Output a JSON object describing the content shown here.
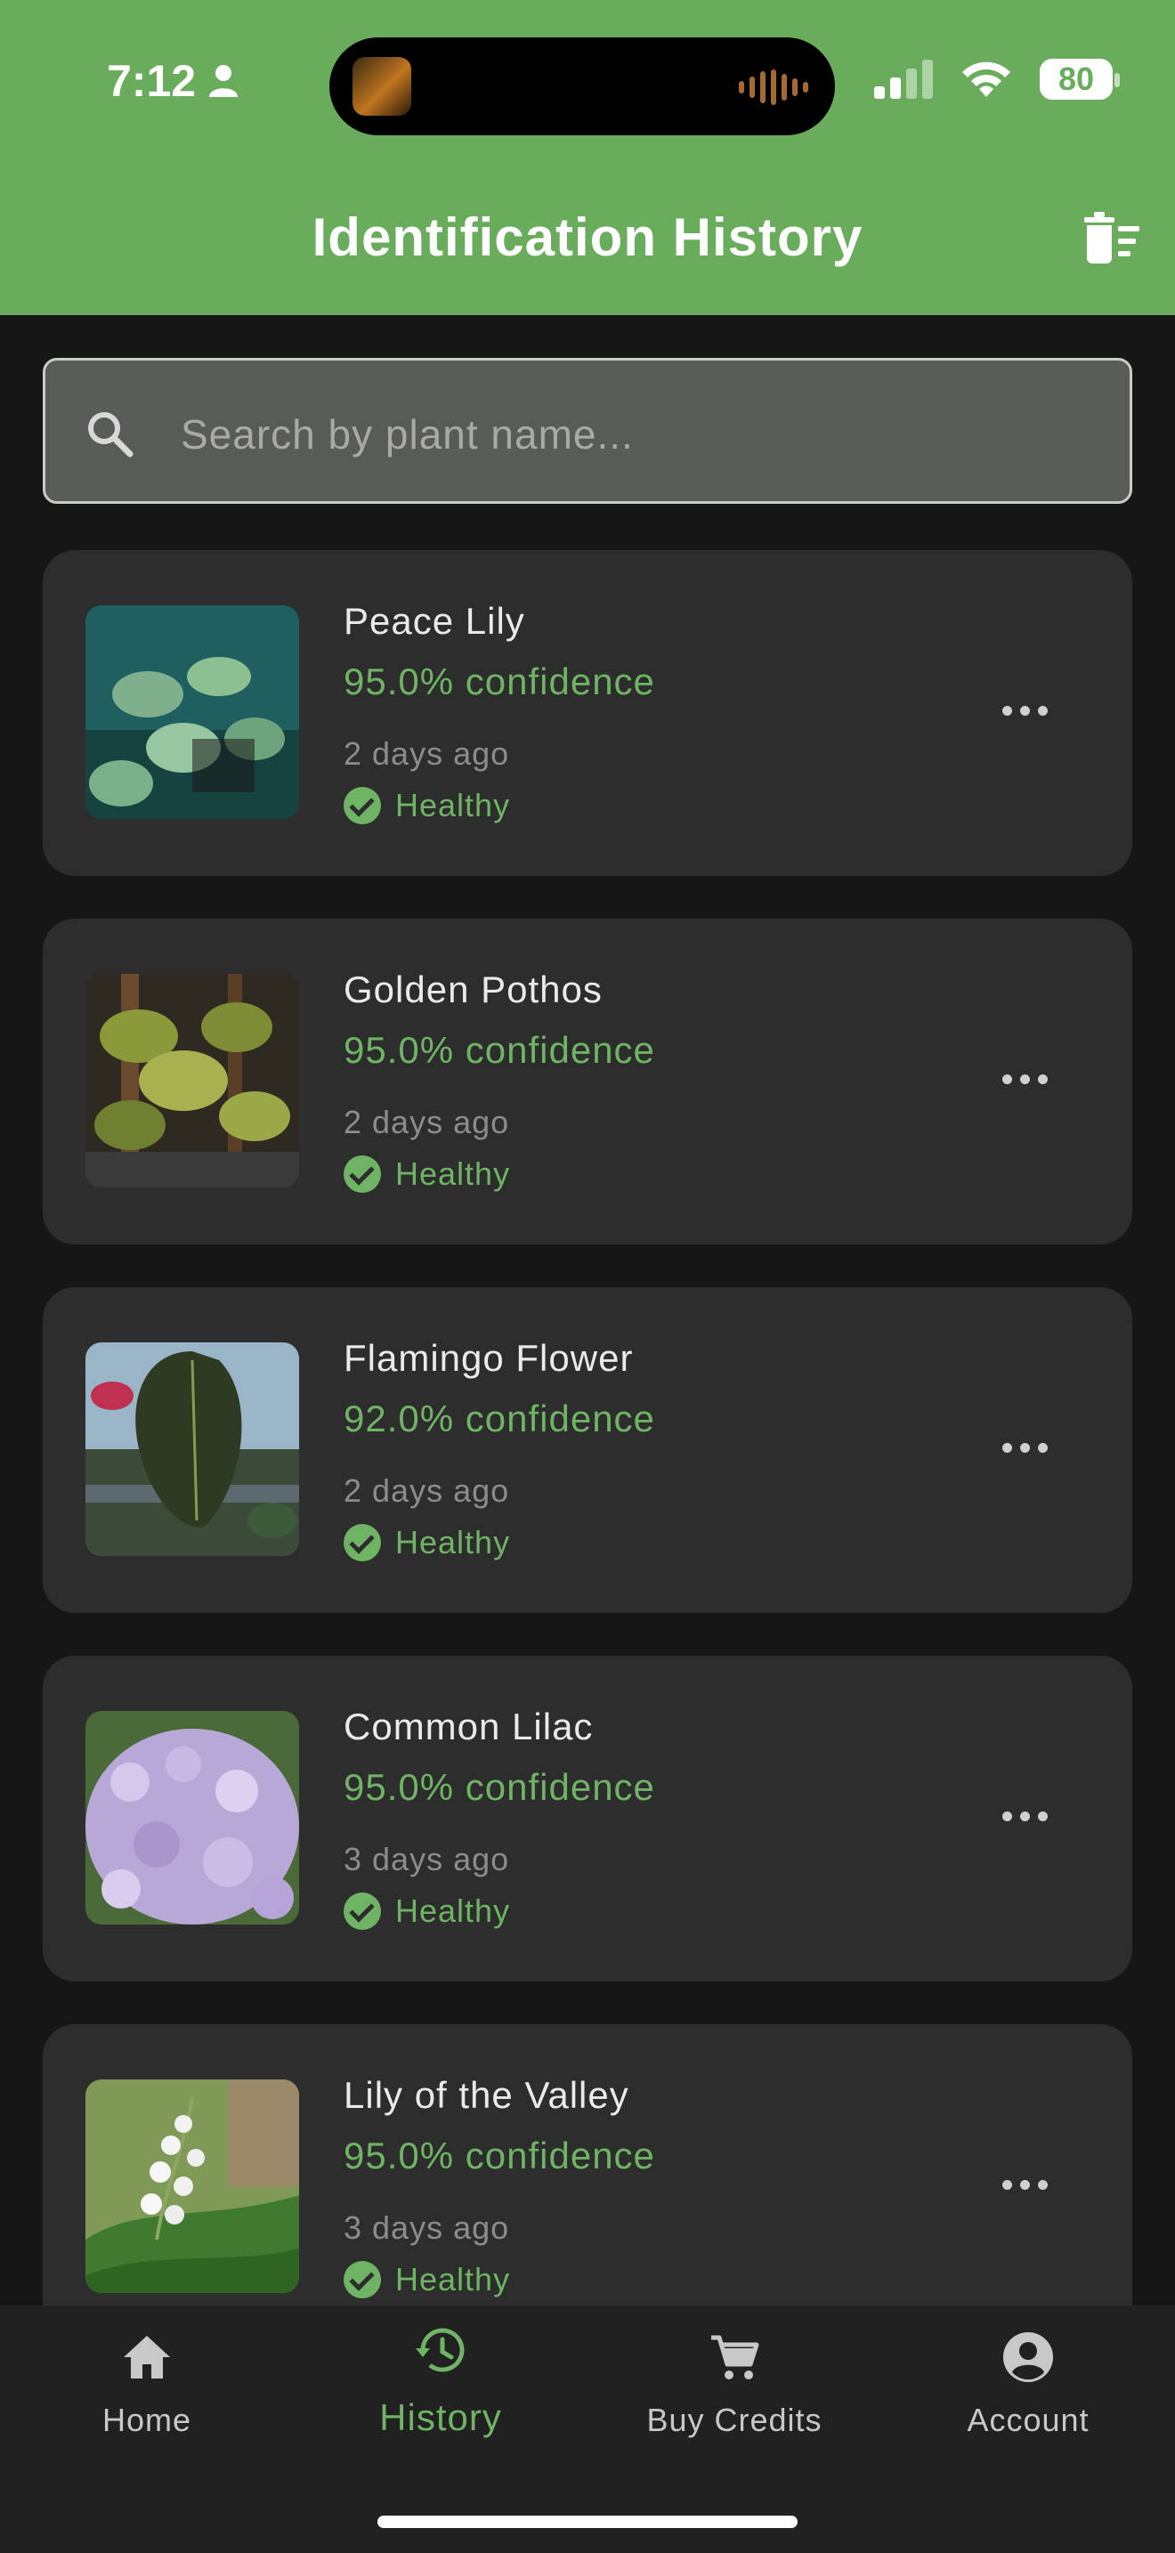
{
  "status_bar": {
    "time": "7:12",
    "battery": "80"
  },
  "header": {
    "title": "Identification History"
  },
  "search": {
    "placeholder": "Search by plant name..."
  },
  "history": [
    {
      "name": "Peace Lily",
      "confidence": "95.0% confidence",
      "when": "2 days ago",
      "status": "Healthy"
    },
    {
      "name": "Golden Pothos",
      "confidence": "95.0% confidence",
      "when": "2 days ago",
      "status": "Healthy"
    },
    {
      "name": "Flamingo Flower",
      "confidence": "92.0% confidence",
      "when": "2 days ago",
      "status": "Healthy"
    },
    {
      "name": "Common Lilac",
      "confidence": "95.0% confidence",
      "when": "3 days ago",
      "status": "Healthy"
    },
    {
      "name": "Lily of the Valley",
      "confidence": "95.0% confidence",
      "when": "3 days ago",
      "status": "Healthy"
    }
  ],
  "nav": {
    "items": [
      {
        "label": "Home",
        "icon": "home-icon"
      },
      {
        "label": "History",
        "icon": "history-icon",
        "active": true
      },
      {
        "label": "Buy Credits",
        "icon": "cart-icon"
      },
      {
        "label": "Account",
        "icon": "account-icon"
      }
    ]
  },
  "colors": {
    "accent": "#69ad5c",
    "text_green": "#6fb364",
    "card": "#2d2d2d",
    "background": "#161616"
  }
}
